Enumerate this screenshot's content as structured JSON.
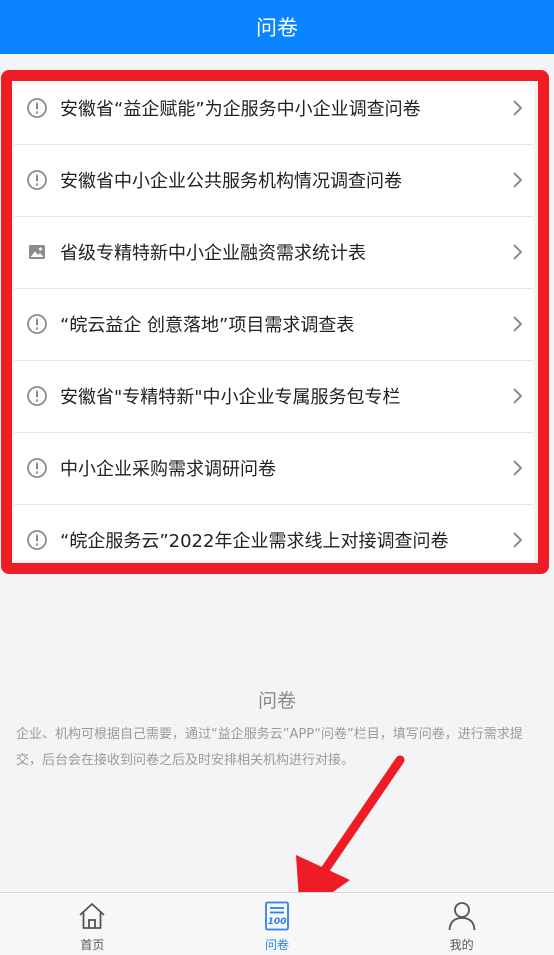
{
  "header": {
    "title": "问卷"
  },
  "colors": {
    "header_bg": "#0a84ff",
    "highlight": "#ee1c25",
    "active_tab": "#2f80e8"
  },
  "list": {
    "items": [
      {
        "label": "安徽省“益企赋能”为企服务中小企业调查问卷",
        "icon": "info-circle-icon"
      },
      {
        "label": "安徽省中小企业公共服务机构情况调查问卷",
        "icon": "info-circle-icon"
      },
      {
        "label": "省级专精特新中小企业融资需求统计表",
        "icon": "image-icon"
      },
      {
        "label": "“皖云益企 创意落地”项目需求调查表",
        "icon": "info-circle-icon"
      },
      {
        "label": "安徽省\"专精特新\"中小企业专属服务包专栏",
        "icon": "info-circle-icon"
      },
      {
        "label": "中小企业采购需求调研问卷",
        "icon": "info-circle-icon"
      },
      {
        "label": "“皖企服务云”2022年企业需求线上对接调查问卷",
        "icon": "info-circle-icon"
      }
    ]
  },
  "info": {
    "title": "问卷",
    "description": "企业、机构可根据自己需要，通过“益企服务云”APP“问卷”栏目，填写问卷，进行需求提交，后台会在接收到问卷之后及时安排相关机构进行对接。"
  },
  "tabbar": {
    "tabs": [
      {
        "label": "首页",
        "icon": "home-icon",
        "active": false
      },
      {
        "label": "问卷",
        "icon": "questionnaire-icon",
        "active": true
      },
      {
        "label": "我的",
        "icon": "user-icon",
        "active": false
      }
    ]
  }
}
